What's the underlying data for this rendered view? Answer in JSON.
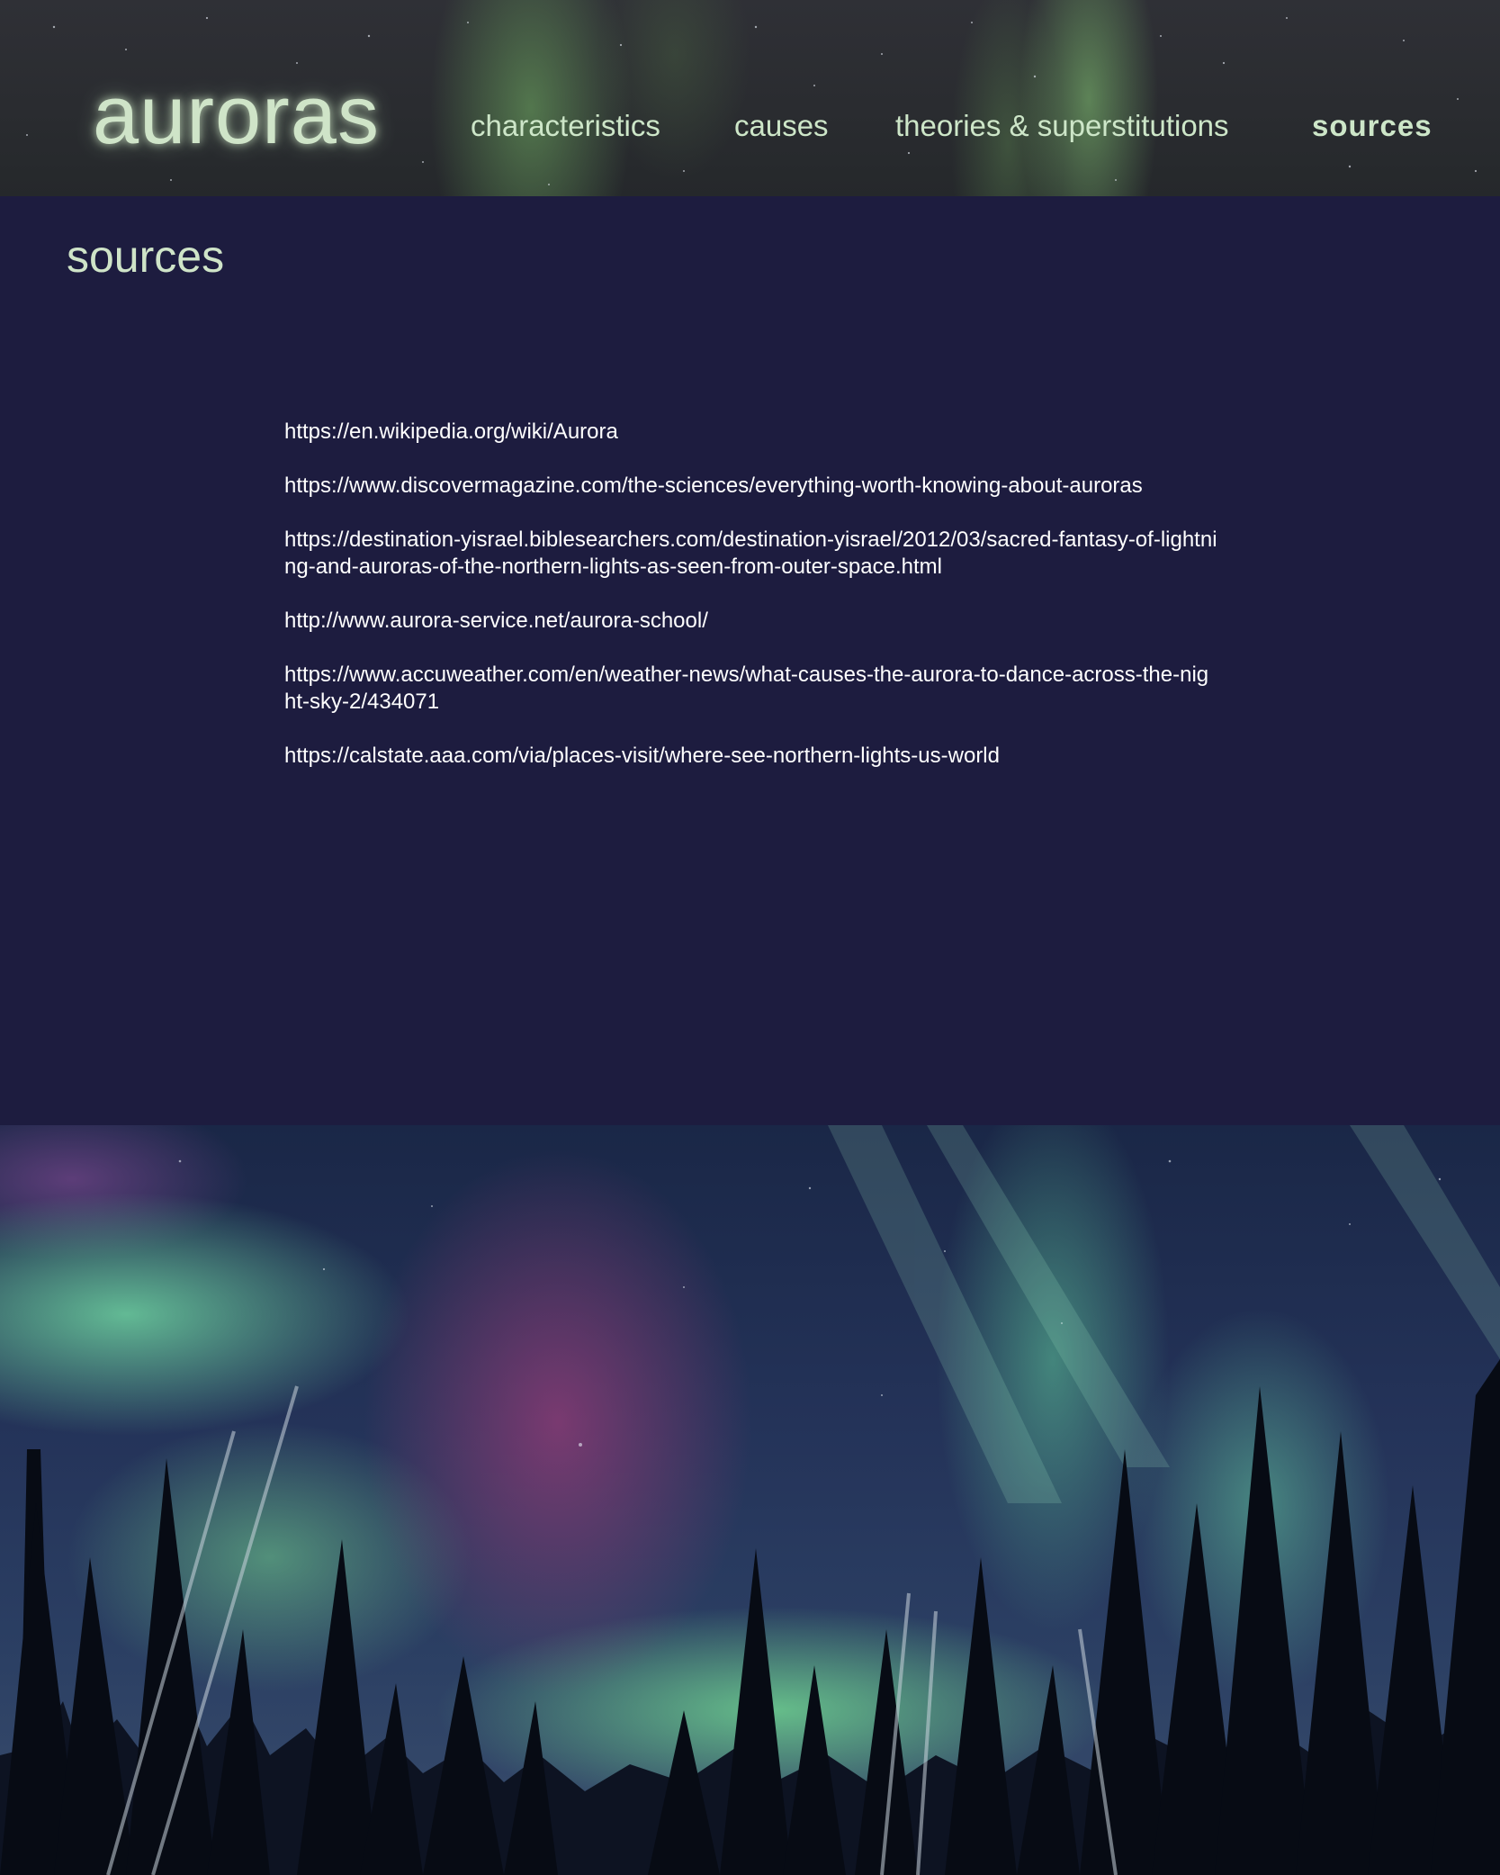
{
  "site": {
    "logo": "auroras"
  },
  "nav": {
    "items": [
      {
        "label": "characteristics"
      },
      {
        "label": "causes"
      },
      {
        "label": "theories & superstitutions"
      },
      {
        "label": "sources",
        "active": true
      }
    ]
  },
  "main": {
    "title": "sources",
    "sources": [
      "https://en.wikipedia.org/wiki/Aurora",
      "https://www.discovermagazine.com/the-sciences/everything-worth-knowing-about-auroras",
      "https://destination-yisrael.biblesearchers.com/destination-yisrael/2012/03/sacred-fantasy-of-lightning-and-auroras-of-the-northern-lights-as-seen-from-outer-space.html",
      "http://www.aurora-service.net/aurora-school/",
      "https://www.accuweather.com/en/weather-news/what-causes-the-aurora-to-dance-across-the-night-sky-2/434071",
      "https://calstate.aaa.com/via/places-visit/where-see-northern-lights-us-world"
    ]
  },
  "colors": {
    "background": "#1d1c3f",
    "accent_text": "#cfe4c8",
    "link_text": "#ffffff"
  }
}
